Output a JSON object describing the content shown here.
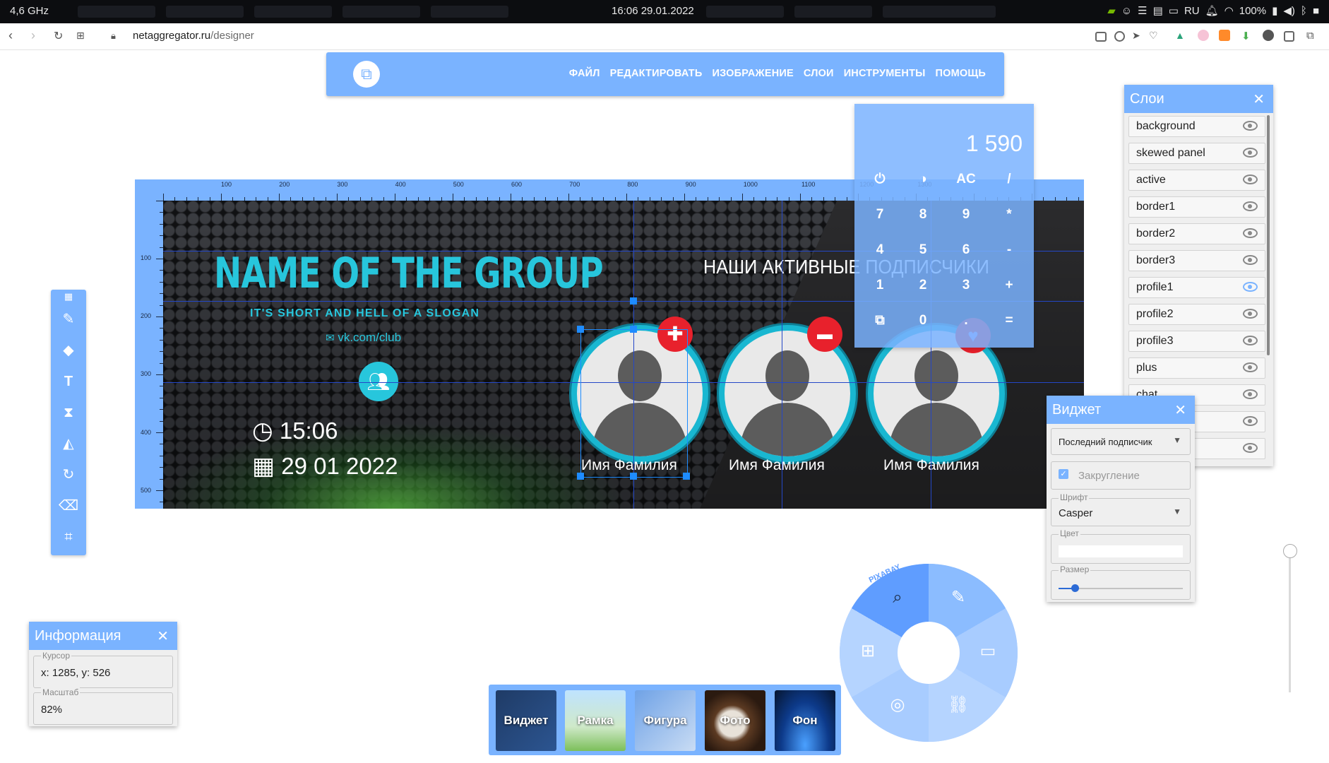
{
  "system_bar": {
    "cpu": "4,6 GHz",
    "datetime": "16:06 29.01.2022",
    "lang": "RU",
    "battery": "100%"
  },
  "browser": {
    "url_host": "netaggregator.ru",
    "url_path": "/designer"
  },
  "menu": {
    "items": [
      "ФАЙЛ",
      "РЕДАКТИРОВАТЬ",
      "ИЗОБРАЖЕНИЕ",
      "СЛОИ",
      "ИНСТРУМЕНТЫ",
      "ПОМОЩЬ"
    ]
  },
  "rulers": {
    "top_ticks": [
      "100",
      "200",
      "300",
      "400",
      "500",
      "600",
      "700",
      "800",
      "900",
      "1000",
      "1100",
      "1200",
      "1300"
    ],
    "left_ticks": [
      "100",
      "200",
      "300",
      "400",
      "500"
    ]
  },
  "banner": {
    "group_title": "NAME OF THE GROUP",
    "slogan": "IT'S SHORT AND HELL OF A SLOGAN",
    "vk_link": "vk.com/club",
    "time": "15:06",
    "date": "29 01 2022",
    "active_title": "НАШИ АКТИВНЫЕ ПОДПИСЧИКИ",
    "profiles": [
      {
        "name": "Имя Фамилия"
      },
      {
        "name": "Имя Фамилия"
      },
      {
        "name": "Имя Фамилия"
      }
    ]
  },
  "calculator": {
    "display": "1 590",
    "keys": [
      [
        "⏻",
        "◑",
        "AC",
        "/"
      ],
      [
        "7",
        "8",
        "9",
        "*"
      ],
      [
        "4",
        "5",
        "6",
        "-"
      ],
      [
        "1",
        "2",
        "3",
        "+"
      ],
      [
        "⧉",
        "0",
        ".",
        "="
      ]
    ]
  },
  "layers": {
    "title": "Слои",
    "items": [
      "background",
      "skewed panel",
      "active",
      "border1",
      "border2",
      "border3",
      "profile1",
      "profile2",
      "profile3",
      "plus",
      "chat",
      "",
      ""
    ]
  },
  "widget": {
    "title": "Виджет",
    "type_value": "Последний подписчик",
    "rounding_label": "Закругление",
    "font_label": "Шрифт",
    "font_value": "Casper",
    "color_label": "Цвет",
    "size_label": "Размер",
    "size_level": 0.13
  },
  "info": {
    "title": "Информация",
    "cursor_label": "Курсор",
    "cursor_value": "x: 1285, y: 526",
    "scale_label": "Масштаб",
    "scale_value": "82%"
  },
  "dock": {
    "items": [
      "Виджет",
      "Рамка",
      "Фигура",
      "Фото",
      "Фон"
    ]
  },
  "radial": {
    "pixabay": "PIXABAY"
  },
  "colors": {
    "accent": "#7ab3ff",
    "cyan": "#27c6dc",
    "red": "#e8212c"
  }
}
